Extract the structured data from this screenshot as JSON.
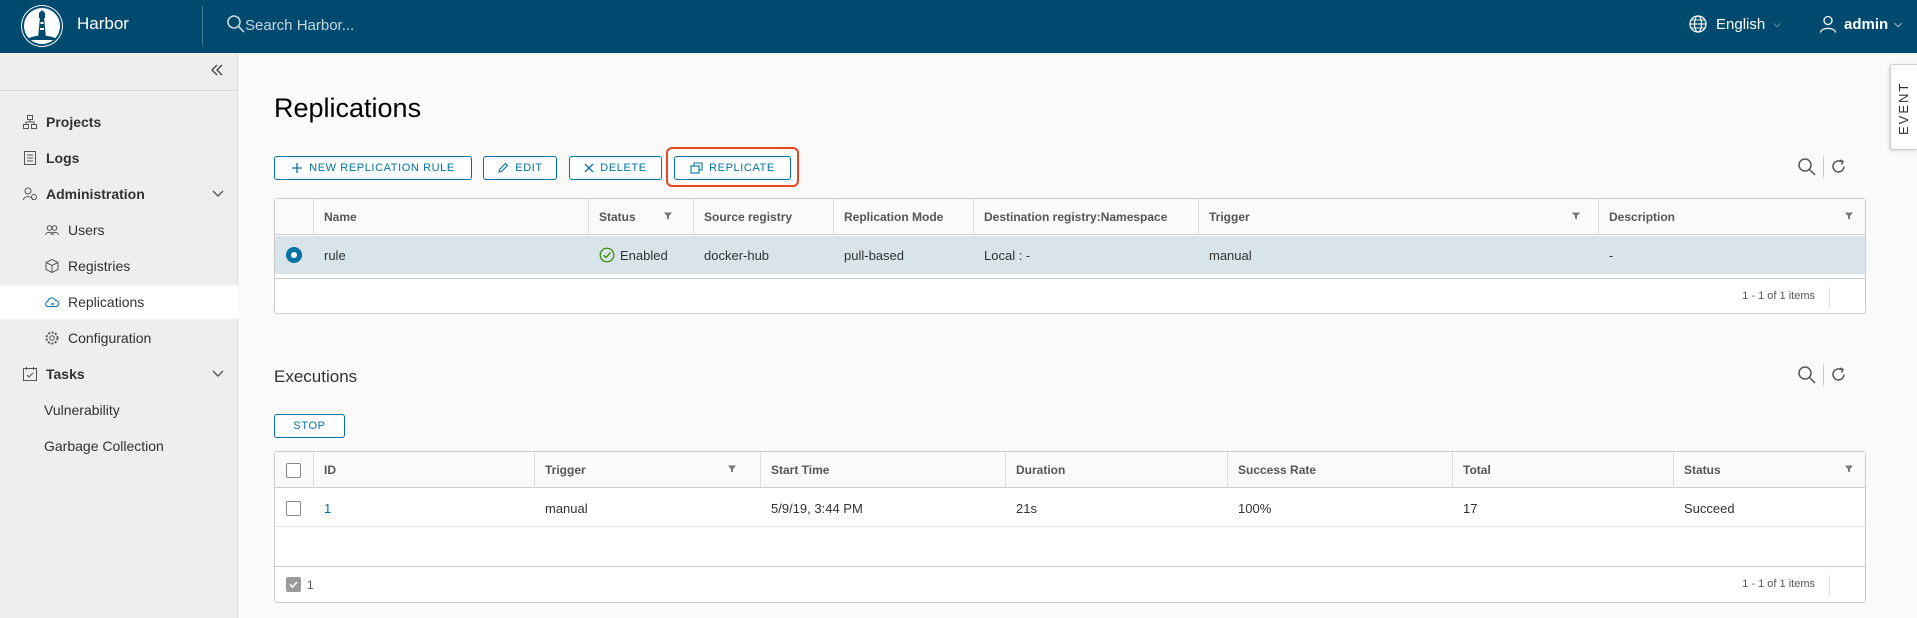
{
  "header": {
    "brand": "Harbor",
    "search_placeholder": "Search Harbor...",
    "language": "English",
    "user": "admin"
  },
  "sidebar": {
    "items": [
      {
        "label": "Projects"
      },
      {
        "label": "Logs"
      },
      {
        "label": "Administration"
      },
      {
        "label": "Users"
      },
      {
        "label": "Registries"
      },
      {
        "label": "Replications"
      },
      {
        "label": "Configuration"
      },
      {
        "label": "Tasks"
      },
      {
        "label": "Vulnerability"
      },
      {
        "label": "Garbage Collection"
      }
    ]
  },
  "page": {
    "title": "Replications",
    "event_tab": "EVENT"
  },
  "toolbar": {
    "new_rule": "NEW REPLICATION RULE",
    "edit": "EDIT",
    "delete": "DELETE",
    "replicate": "REPLICATE"
  },
  "rules": {
    "columns": [
      "Name",
      "Status",
      "Source registry",
      "Replication Mode",
      "Destination registry:Namespace",
      "Trigger",
      "Description"
    ],
    "rows": [
      {
        "name": "rule",
        "status": "Enabled",
        "source": "docker-hub",
        "mode": "pull-based",
        "destination": "Local : -",
        "trigger": "manual",
        "description": "-"
      }
    ],
    "footer": "1 - 1 of 1 items"
  },
  "executions": {
    "title": "Executions",
    "stop": "STOP",
    "columns": [
      "ID",
      "Trigger",
      "Start Time",
      "Duration",
      "Success Rate",
      "Total",
      "Status"
    ],
    "rows": [
      {
        "id": "1",
        "trigger": "manual",
        "start": "5/9/19, 3:44 PM",
        "duration": "21s",
        "rate": "100%",
        "total": "17",
        "status": "Succeed"
      }
    ],
    "selected_count": "1",
    "footer": "1 - 1 of 1 items"
  },
  "colors": {
    "header": "#004a70",
    "accent": "#0072a3",
    "highlight": "#e6491e",
    "success": "#318700"
  }
}
